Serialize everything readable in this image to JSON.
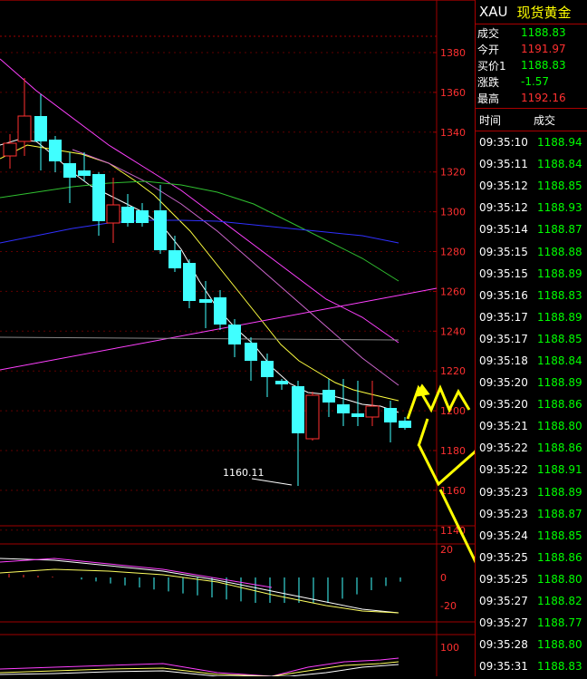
{
  "header": {
    "symbol": "XAU",
    "name": "现货黄金"
  },
  "quote": [
    {
      "label": "成交",
      "value": "1188.83",
      "color": "#00ff00"
    },
    {
      "label": "今开",
      "value": "1191.97",
      "color": "#ff3030"
    },
    {
      "label": "买价1",
      "value": "1188.83",
      "color": "#00ff00"
    },
    {
      "label": "涨跌",
      "value": "-1.57",
      "color": "#00ff00"
    },
    {
      "label": "最高",
      "value": "1192.16",
      "color": "#ff3030"
    }
  ],
  "ticks_header": {
    "time": "时间",
    "price": "成交"
  },
  "ticks": [
    {
      "time": "09:35:10",
      "price": "1188.94"
    },
    {
      "time": "09:35:11",
      "price": "1188.84"
    },
    {
      "time": "09:35:12",
      "price": "1188.85"
    },
    {
      "time": "09:35:12",
      "price": "1188.93"
    },
    {
      "time": "09:35:14",
      "price": "1188.87"
    },
    {
      "time": "09:35:15",
      "price": "1188.88"
    },
    {
      "time": "09:35:15",
      "price": "1188.89"
    },
    {
      "time": "09:35:16",
      "price": "1188.83"
    },
    {
      "time": "09:35:17",
      "price": "1188.89"
    },
    {
      "time": "09:35:17",
      "price": "1188.85"
    },
    {
      "time": "09:35:18",
      "price": "1188.84"
    },
    {
      "time": "09:35:20",
      "price": "1188.89"
    },
    {
      "time": "09:35:20",
      "price": "1188.86"
    },
    {
      "time": "09:35:21",
      "price": "1188.80"
    },
    {
      "time": "09:35:22",
      "price": "1188.86"
    },
    {
      "time": "09:35:22",
      "price": "1188.91"
    },
    {
      "time": "09:35:23",
      "price": "1188.89"
    },
    {
      "time": "09:35:23",
      "price": "1188.87"
    },
    {
      "time": "09:35:24",
      "price": "1188.85"
    },
    {
      "time": "09:35:25",
      "price": "1188.86"
    },
    {
      "time": "09:35:25",
      "price": "1188.80"
    },
    {
      "time": "09:35:27",
      "price": "1188.82"
    },
    {
      "time": "09:35:27",
      "price": "1188.77"
    },
    {
      "time": "09:35:28",
      "price": "1188.80"
    },
    {
      "time": "09:35:31",
      "price": "1188.83"
    }
  ],
  "chart": {
    "price_axis": [
      "1380",
      "1360",
      "1340",
      "1320",
      "1300",
      "1280",
      "1260",
      "1240",
      "1220",
      "1200",
      "1180",
      "1160",
      "1140"
    ],
    "low_label": "1160.11",
    "macd_axis": [
      "20",
      "0",
      "-20"
    ],
    "kdj_axis": [
      "100"
    ],
    "colors": {
      "up": "#ff3030",
      "down": "#40ffff",
      "grid": "#a00000"
    }
  }
}
